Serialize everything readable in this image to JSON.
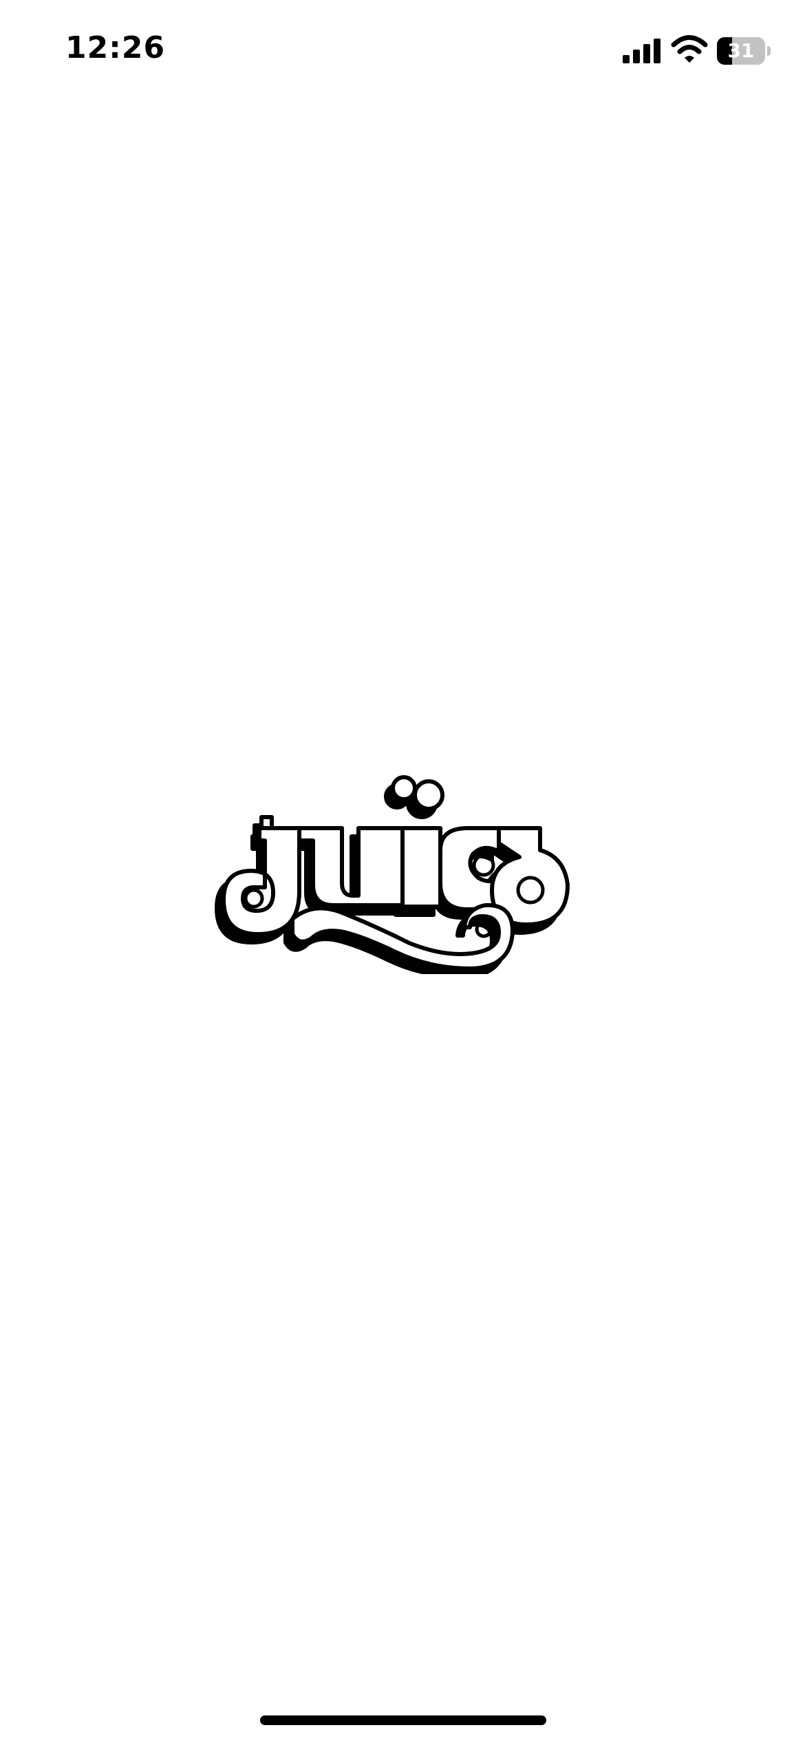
{
  "status_bar": {
    "time": "12:26",
    "battery_level": "31",
    "battery_fraction": 0.31,
    "icons": [
      "signal-icon",
      "wifi-icon",
      "battery-icon"
    ]
  },
  "splash": {
    "logo_text": "juice",
    "logo_colors": {
      "outline": "#000000",
      "fill": "#ffffff",
      "shadow": "#000000"
    }
  },
  "home_indicator": {
    "color": "#000000"
  }
}
